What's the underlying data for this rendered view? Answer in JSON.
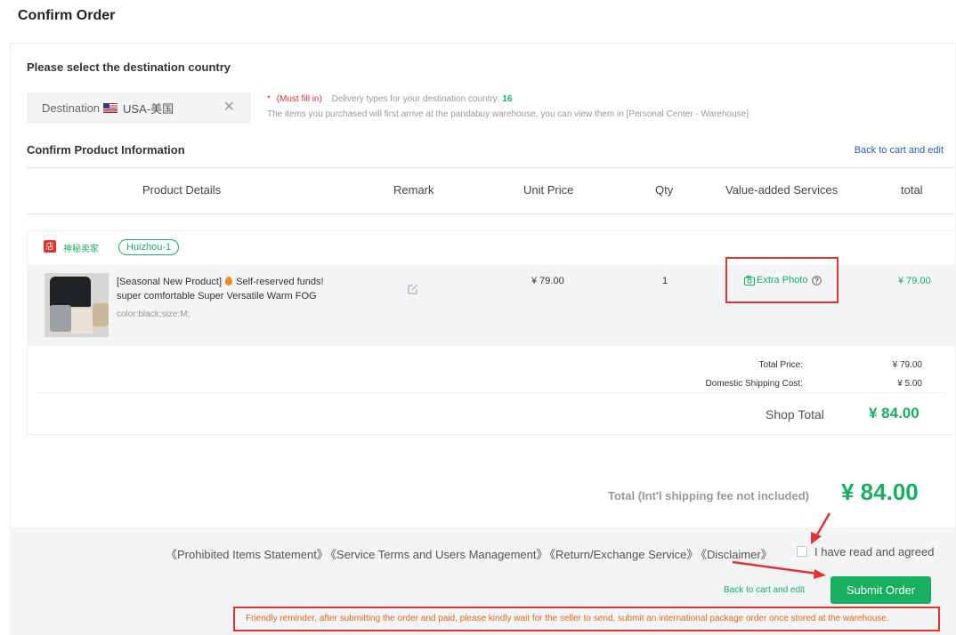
{
  "page": {
    "title": "Confirm Order"
  },
  "destination": {
    "section_title": "Please select the destination country",
    "label": "Destination",
    "value": "USA-美国",
    "close_glyph": "✕",
    "required_mark": "*",
    "must_fill": "(Must fill in)",
    "delivery_text": "Delivery types for your destination country:",
    "delivery_count": "16",
    "warehouse_note": "The items you purchased will first arrive at the pandabuy warehouse, you can view them in [Personal Center - Warehouse]"
  },
  "product_info": {
    "section_title": "Confirm Product Information",
    "back_link": "Back to cart and edit",
    "columns": [
      "Product Details",
      "Remark",
      "Unit Price",
      "Qty",
      "Value-added Services",
      "total"
    ]
  },
  "shop": {
    "icon_char": "店",
    "name": "神秘卖家",
    "warehouse_tag": "Huizhou-1"
  },
  "item": {
    "title_part1": "[Seasonal New Product]",
    "title_part2": "Self-reserved funds!",
    "title_line2": "super comfortable Super Versatile Warm FOG",
    "attributes": "color:black;size:M;",
    "unit_price": "¥ 79.00",
    "qty": "1",
    "service": "Extra Photo",
    "total": "¥ 79.00"
  },
  "summary": {
    "total_price_label": "Total Price:",
    "total_price": "¥ 79.00",
    "shipping_label": "Domestic Shipping Cost:",
    "shipping": "¥ 5.00",
    "shop_total_label": "Shop Total",
    "shop_total": "¥ 84.00"
  },
  "grand": {
    "label": "Total (Int'l shipping fee not included)",
    "value": "¥ 84.00"
  },
  "footer": {
    "terms": [
      "《Prohibited Items Statement》",
      "《Service Terms and Users Management》",
      "《Return/Exchange Service》",
      "《Disclaimer》"
    ],
    "agree_label": "I have read and agreed",
    "back_link": "Back to cart and edit",
    "submit_label": "Submit Order",
    "reminder": "Friendly reminder, after submitting the order and paid, please kindly wait for the seller to send, submit an international package order once stored at the warehouse."
  },
  "colors": {
    "accent": "#17b061",
    "alert": "#e0342f",
    "link": "#2a5db0",
    "reminder_text": "#e06a1a"
  }
}
